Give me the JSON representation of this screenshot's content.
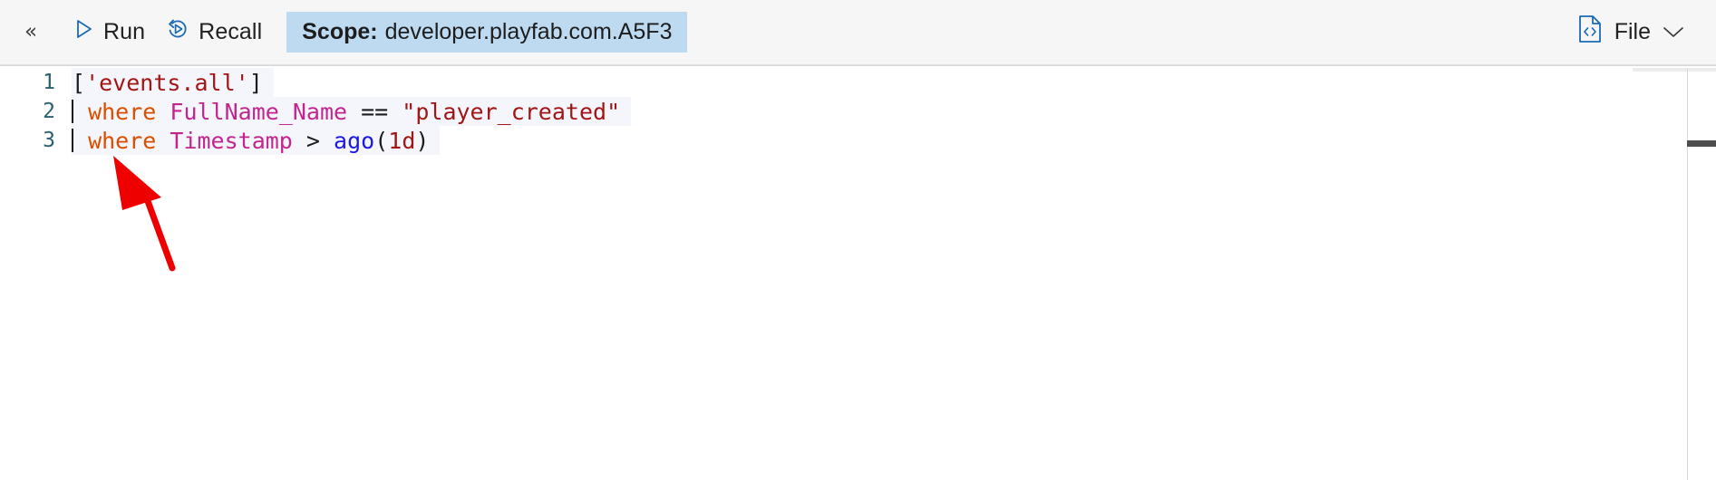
{
  "toolbar": {
    "collapse_label": "«",
    "collapse_icon": "chevron-double-left-icon",
    "run": {
      "label": "Run",
      "icon": "play-triangle-icon"
    },
    "recall": {
      "label": "Recall",
      "icon": "replay-circle-icon"
    },
    "scope": {
      "key": "Scope:",
      "value": "developer.playfab.com.A5F3",
      "background": "#bedaf0"
    },
    "file": {
      "label": "File",
      "icon": "code-file-icon",
      "chevron_icon": "chevron-down-icon"
    }
  },
  "editor": {
    "language": "kusto",
    "lines": [
      {
        "number": "1",
        "caret": false,
        "tokens": [
          {
            "text": "[",
            "kind": "punct"
          },
          {
            "text": "'events.all'",
            "kind": "string"
          },
          {
            "text": "]",
            "kind": "punct"
          }
        ],
        "plain": "['events.all']"
      },
      {
        "number": "2",
        "caret": true,
        "tokens": [
          {
            "text": " ",
            "kind": "punct"
          },
          {
            "text": "where",
            "kind": "keyword"
          },
          {
            "text": " ",
            "kind": "punct"
          },
          {
            "text": "FullName_Name",
            "kind": "column"
          },
          {
            "text": " ",
            "kind": "punct"
          },
          {
            "text": "==",
            "kind": "op"
          },
          {
            "text": " ",
            "kind": "punct"
          },
          {
            "text": "\"player_created\"",
            "kind": "string"
          }
        ],
        "plain": "| where FullName_Name == \"player_created\""
      },
      {
        "number": "3",
        "caret": true,
        "tokens": [
          {
            "text": " ",
            "kind": "punct"
          },
          {
            "text": "where",
            "kind": "keyword"
          },
          {
            "text": " ",
            "kind": "punct"
          },
          {
            "text": "Timestamp",
            "kind": "column"
          },
          {
            "text": " ",
            "kind": "punct"
          },
          {
            "text": ">",
            "kind": "op"
          },
          {
            "text": " ",
            "kind": "punct"
          },
          {
            "text": "ago",
            "kind": "func"
          },
          {
            "text": "(",
            "kind": "punct"
          },
          {
            "text": "1d",
            "kind": "literal"
          },
          {
            "text": ")",
            "kind": "punct"
          }
        ],
        "plain": "| where Timestamp > ago(1d)"
      }
    ]
  },
  "annotation": {
    "arrow_color": "#ee0000",
    "arrow_points_to": "line-3-start"
  },
  "colors": {
    "accent": "#0078d4",
    "toolbar_bg": "#f6f6f6",
    "scope_chip_bg": "#bedaf0",
    "line_highlight": "#f4f6fb",
    "gutter_text": "#2b6070",
    "keyword": "#d94f00",
    "column": "#c2258f",
    "string": "#a31515",
    "function": "#1a1ae0"
  }
}
